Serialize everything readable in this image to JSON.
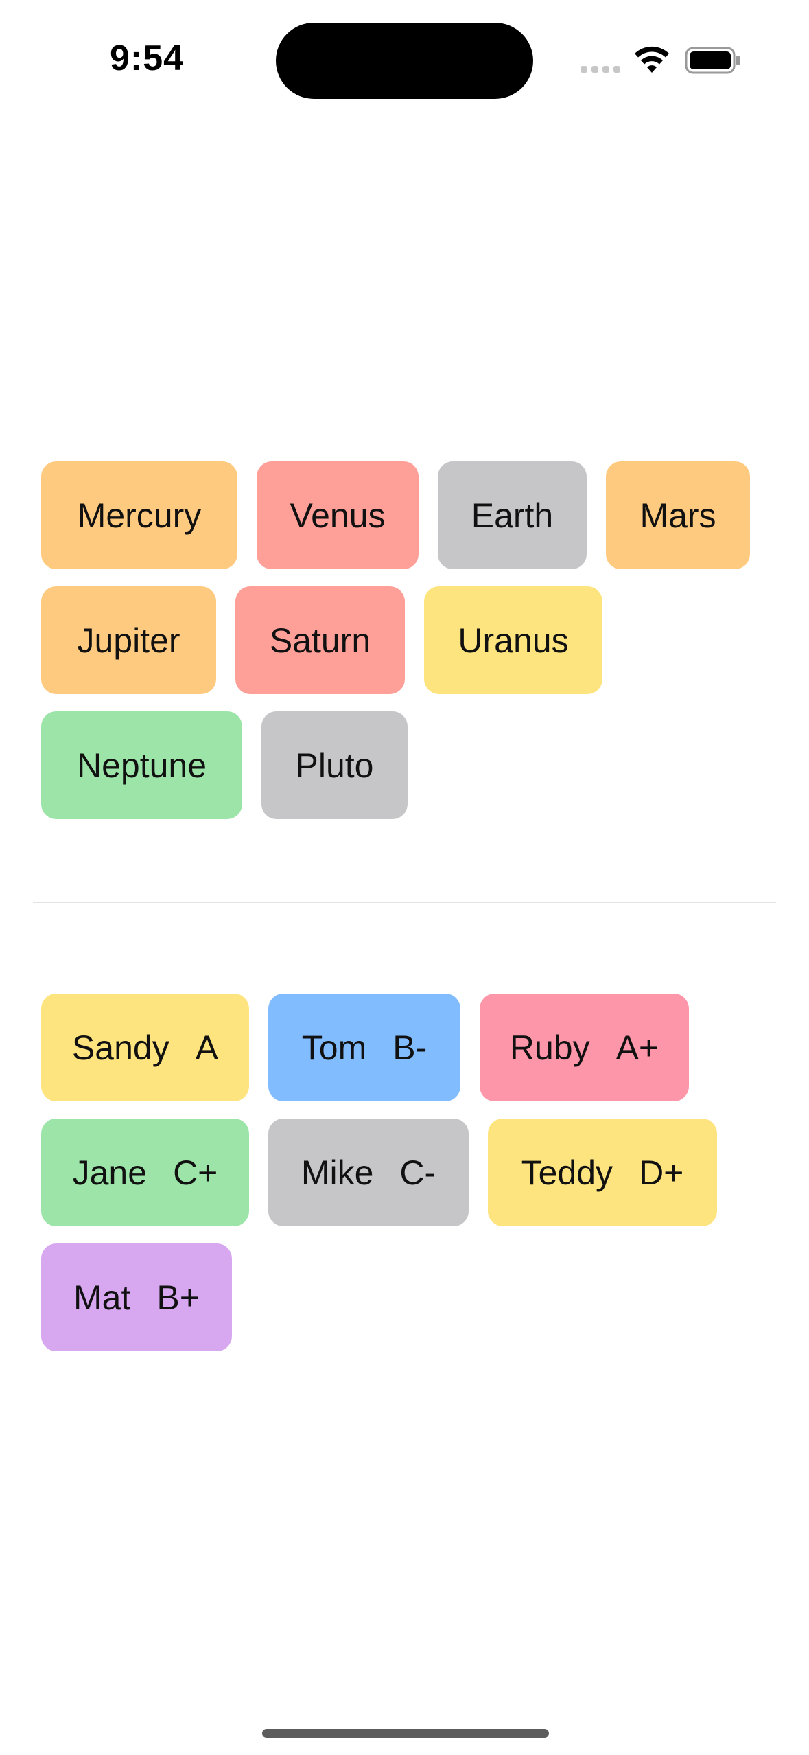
{
  "status_bar": {
    "time": "9:54"
  },
  "colors": {
    "orange": "#FECA80",
    "red": "#FE9F98",
    "gray": "#C6C6C8",
    "yellow": "#FDE47F",
    "green": "#9DE4A9",
    "blue": "#80BCFE",
    "pink": "#FE96A9",
    "purple": "#D7A7F0"
  },
  "planets": [
    {
      "label": "Mercury",
      "color": "orange"
    },
    {
      "label": "Venus",
      "color": "red"
    },
    {
      "label": "Earth",
      "color": "gray"
    },
    {
      "label": "Mars",
      "color": "orange"
    },
    {
      "label": "Jupiter",
      "color": "orange"
    },
    {
      "label": "Saturn",
      "color": "red"
    },
    {
      "label": "Uranus",
      "color": "yellow"
    },
    {
      "label": "Neptune",
      "color": "green"
    },
    {
      "label": "Pluto",
      "color": "gray"
    }
  ],
  "students": [
    {
      "name": "Sandy",
      "grade": "A",
      "color": "yellow"
    },
    {
      "name": "Tom",
      "grade": "B-",
      "color": "blue"
    },
    {
      "name": "Ruby",
      "grade": "A+",
      "color": "pink"
    },
    {
      "name": "Jane",
      "grade": "C+",
      "color": "green"
    },
    {
      "name": "Mike",
      "grade": "C-",
      "color": "gray"
    },
    {
      "name": "Teddy",
      "grade": "D+",
      "color": "yellow"
    },
    {
      "name": "Mat",
      "grade": "B+",
      "color": "purple"
    }
  ]
}
